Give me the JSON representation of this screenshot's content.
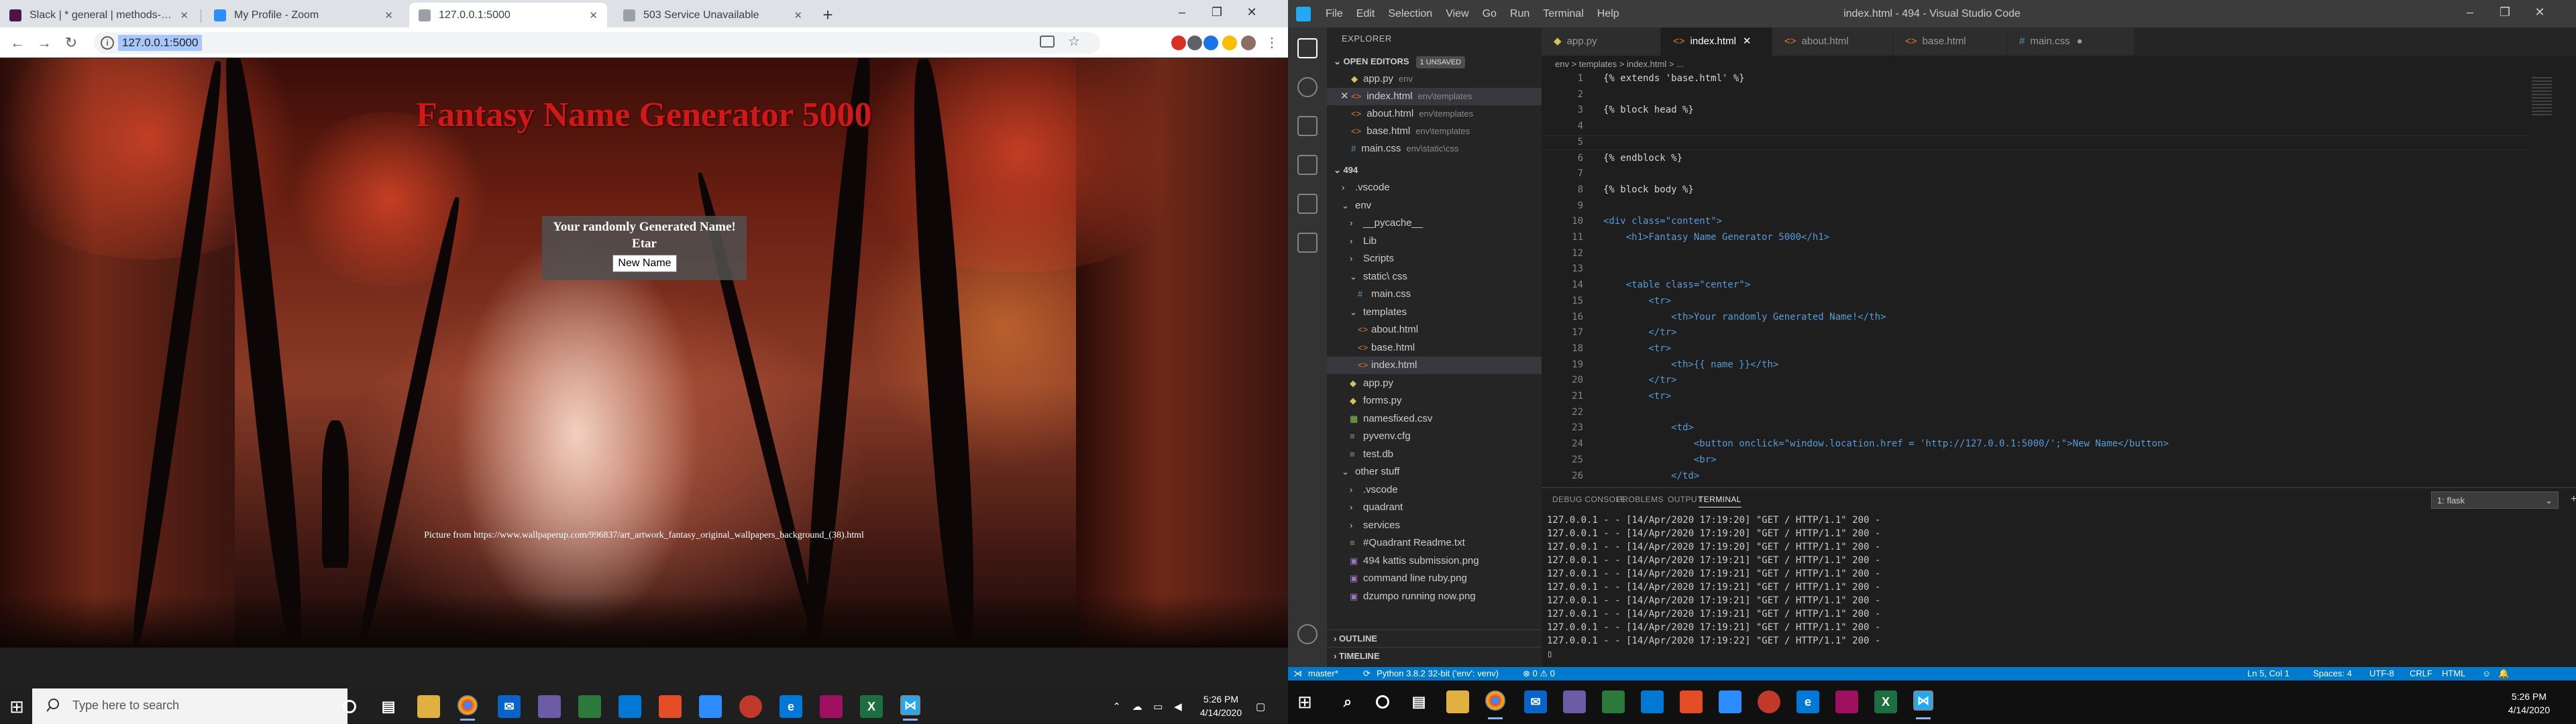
{
  "browser": {
    "tabs": [
      {
        "title": "Slack | * general | methods-spring",
        "favicon_color": "#4a154b"
      },
      {
        "title": "My Profile - Zoom",
        "favicon_color": "#2d8cff"
      },
      {
        "title": "127.0.0.1:5000",
        "favicon_color": "#9aa0a6",
        "active": true
      },
      {
        "title": "503 Service Unavailable",
        "favicon_color": "#9aa0a6"
      }
    ],
    "url": "127.0.0.1:5000"
  },
  "page": {
    "title": "Fantasy Name Generator 5000",
    "name_header": "Your randomly Generated Name!",
    "generated_name": "Etar",
    "new_name_label": "New Name",
    "credit": "Picture from https://www.wallpaperup.com/996837/art_artwork_fantasy_original_wallpapers_background_(38).html"
  },
  "taskbar_left": {
    "search_placeholder": "Type here to search",
    "time": "5:26 PM",
    "date": "4/14/2020"
  },
  "vscode": {
    "menu": [
      "File",
      "Edit",
      "Selection",
      "View",
      "Go",
      "Run",
      "Terminal",
      "Help"
    ],
    "window_title": "index.html - 494 - Visual Studio Code",
    "explorer_label": "EXPLORER",
    "open_editors": {
      "label": "OPEN EDITORS",
      "badge": "1 UNSAVED",
      "items": [
        {
          "name": "app.py",
          "path": "env",
          "kind": "py"
        },
        {
          "name": "index.html",
          "path": "env\\templates",
          "kind": "html",
          "selected": true
        },
        {
          "name": "about.html",
          "path": "env\\templates",
          "kind": "html"
        },
        {
          "name": "base.html",
          "path": "env\\templates",
          "kind": "html"
        },
        {
          "name": "main.css",
          "path": "env\\static\\css",
          "kind": "css"
        }
      ]
    },
    "workspace": {
      "label": "494",
      "items": [
        {
          "name": ".vscode",
          "indent": 1,
          "kind": "folder"
        },
        {
          "name": "env",
          "indent": 1,
          "kind": "folder-open"
        },
        {
          "name": "__pycache__",
          "indent": 2,
          "kind": "folder"
        },
        {
          "name": "Lib",
          "indent": 2,
          "kind": "folder"
        },
        {
          "name": "Scripts",
          "indent": 2,
          "kind": "folder"
        },
        {
          "name": "static\\ css",
          "indent": 2,
          "kind": "folder-open"
        },
        {
          "name": "main.css",
          "indent": 3,
          "kind": "css"
        },
        {
          "name": "templates",
          "indent": 2,
          "kind": "folder-open"
        },
        {
          "name": "about.html",
          "indent": 3,
          "kind": "html"
        },
        {
          "name": "base.html",
          "indent": 3,
          "kind": "html"
        },
        {
          "name": "index.html",
          "indent": 3,
          "kind": "html",
          "selected": true
        },
        {
          "name": "app.py",
          "indent": 2,
          "kind": "py"
        },
        {
          "name": "forms.py",
          "indent": 2,
          "kind": "py"
        },
        {
          "name": "namesfixed.csv",
          "indent": 2,
          "kind": "csv"
        },
        {
          "name": "pyvenv.cfg",
          "indent": 2,
          "kind": "cfg"
        },
        {
          "name": "test.db",
          "indent": 2,
          "kind": "cfg"
        },
        {
          "name": "other stuff",
          "indent": 1,
          "kind": "folder-open"
        },
        {
          "name": ".vscode",
          "indent": 2,
          "kind": "folder"
        },
        {
          "name": "quadrant",
          "indent": 2,
          "kind": "folder"
        },
        {
          "name": "services",
          "indent": 2,
          "kind": "folder"
        },
        {
          "name": "#Quadrant Readme.txt",
          "indent": 2,
          "kind": "cfg"
        },
        {
          "name": "494 kattis submission.png",
          "indent": 2,
          "kind": "png"
        },
        {
          "name": "command line ruby.png",
          "indent": 2,
          "kind": "png"
        },
        {
          "name": "dzumpo running now.png",
          "indent": 2,
          "kind": "png"
        }
      ]
    },
    "outline_label": "OUTLINE",
    "timeline_label": "TIMELINE",
    "editor_tabs": [
      {
        "name": "app.py",
        "kind": "py"
      },
      {
        "name": "index.html",
        "kind": "html",
        "active": true
      },
      {
        "name": "about.html",
        "kind": "html"
      },
      {
        "name": "base.html",
        "kind": "html"
      },
      {
        "name": "main.css",
        "kind": "css",
        "dirty": true
      }
    ],
    "breadcrumb": "env > templates > index.html > ...",
    "code_lines": [
      "{% extends 'base.html' %}",
      "",
      "{% block head %}",
      "",
      "",
      "{% endblock %}",
      "",
      "{% block body %}",
      "",
      "<div class=\"content\">",
      "    <h1>Fantasy Name Generator 5000</h1>",
      "",
      "",
      "    <table class=\"center\">",
      "        <tr>",
      "            <th>Your randomly Generated Name!</th>",
      "        </tr>",
      "        <tr>",
      "            <th>{{ name }}</th>",
      "        </tr>",
      "        <tr>",
      "",
      "            <td>",
      "                <button onclick=\"window.location.href = 'http://127.0.0.1:5000/';\">New Name</button>",
      "                <br>",
      "            </td>"
    ],
    "panel_tabs": [
      "DEBUG CONSOLE",
      "PROBLEMS",
      "OUTPUT",
      "TERMINAL"
    ],
    "terminal_select": "1: flask",
    "terminal_lines": [
      "127.0.0.1 - - [14/Apr/2020 17:19:20] \"GET / HTTP/1.1\" 200 -",
      "127.0.0.1 - - [14/Apr/2020 17:19:20] \"GET / HTTP/1.1\" 200 -",
      "127.0.0.1 - - [14/Apr/2020 17:19:20] \"GET / HTTP/1.1\" 200 -",
      "127.0.0.1 - - [14/Apr/2020 17:19:21] \"GET / HTTP/1.1\" 200 -",
      "127.0.0.1 - - [14/Apr/2020 17:19:21] \"GET / HTTP/1.1\" 200 -",
      "127.0.0.1 - - [14/Apr/2020 17:19:21] \"GET / HTTP/1.1\" 200 -",
      "127.0.0.1 - - [14/Apr/2020 17:19:21] \"GET / HTTP/1.1\" 200 -",
      "127.0.0.1 - - [14/Apr/2020 17:19:21] \"GET / HTTP/1.1\" 200 -",
      "127.0.0.1 - - [14/Apr/2020 17:19:21] \"GET / HTTP/1.1\" 200 -",
      "127.0.0.1 - - [14/Apr/2020 17:19:22] \"GET / HTTP/1.1\" 200 -"
    ],
    "status": {
      "branch": "master*",
      "python": "Python 3.8.2 32-bit ('env': venv)",
      "problems": "⊗ 0 ⚠ 0",
      "position": "Ln 5, Col 1",
      "spaces": "Spaces: 4",
      "encoding": "UTF-8",
      "eol": "CRLF",
      "language": "HTML"
    }
  },
  "taskbar_right": {
    "time": "5:26 PM",
    "date": "4/14/2020"
  },
  "colors": {
    "vscode_accent": "#007acc",
    "page_title": "#d01818"
  }
}
